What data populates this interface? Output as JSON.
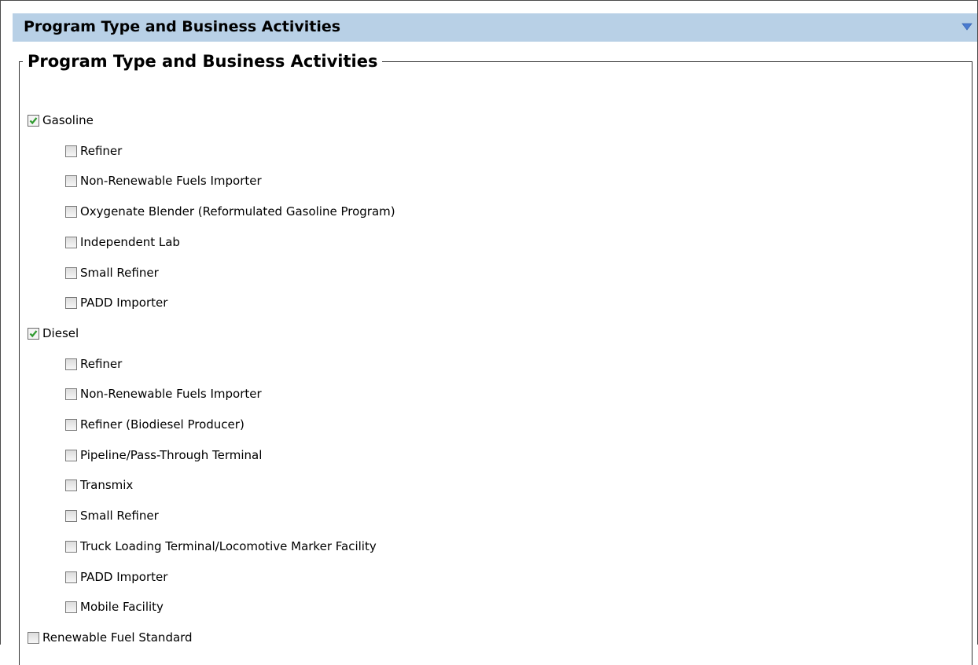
{
  "panel": {
    "title": "Program Type and Business Activities",
    "legend": "Program Type and Business Activities"
  },
  "colors": {
    "header_bg": "#b8d0e6",
    "check_green": "#2e9a2e",
    "collapse_icon": "#4a7bd0"
  },
  "icons": {
    "collapse": "triangle-down-icon",
    "check": "checkmark-icon"
  },
  "options": [
    {
      "label": "Gasoline",
      "checked": true,
      "level": 0
    },
    {
      "label": "Refiner",
      "checked": false,
      "level": 1
    },
    {
      "label": "Non-Renewable Fuels Importer",
      "checked": false,
      "level": 1
    },
    {
      "label": "Oxygenate Blender (Reformulated Gasoline Program)",
      "checked": false,
      "level": 1
    },
    {
      "label": "Independent Lab",
      "checked": false,
      "level": 1
    },
    {
      "label": "Small Refiner",
      "checked": false,
      "level": 1
    },
    {
      "label": "PADD Importer",
      "checked": false,
      "level": 1
    },
    {
      "label": "Diesel",
      "checked": true,
      "level": 0
    },
    {
      "label": "Refiner",
      "checked": false,
      "level": 1
    },
    {
      "label": "Non-Renewable Fuels Importer",
      "checked": false,
      "level": 1
    },
    {
      "label": "Refiner (Biodiesel Producer)",
      "checked": false,
      "level": 1
    },
    {
      "label": "Pipeline/Pass-Through Terminal",
      "checked": false,
      "level": 1
    },
    {
      "label": "Transmix",
      "checked": false,
      "level": 1
    },
    {
      "label": "Small Refiner",
      "checked": false,
      "level": 1
    },
    {
      "label": "Truck Loading Terminal/Locomotive Marker Facility",
      "checked": false,
      "level": 1
    },
    {
      "label": "PADD Importer",
      "checked": false,
      "level": 1
    },
    {
      "label": "Mobile Facility",
      "checked": false,
      "level": 1
    },
    {
      "label": "Renewable Fuel Standard",
      "checked": false,
      "level": 0
    }
  ]
}
